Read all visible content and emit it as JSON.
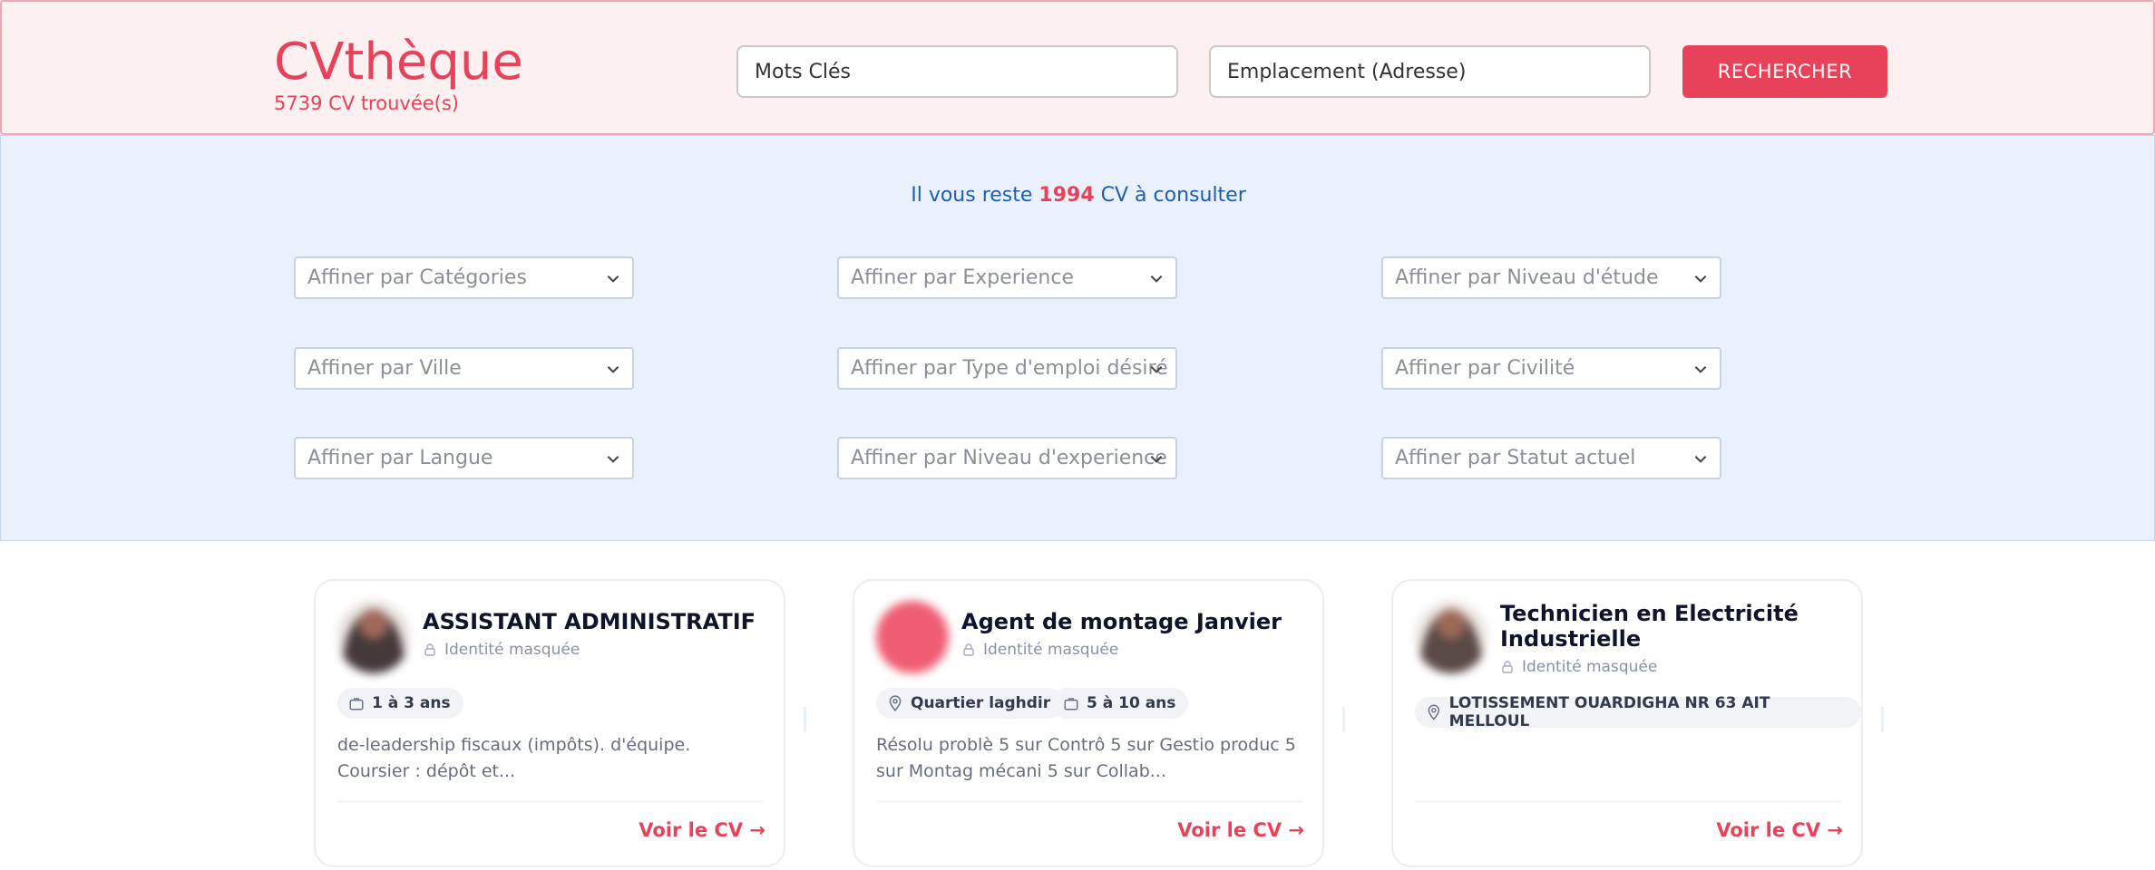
{
  "header": {
    "brand_title": "CVthèque",
    "brand_count": "5739 CV trouvée(s)",
    "keywords_placeholder": "Mots Clés",
    "location_placeholder": "Emplacement (Adresse)",
    "search_label": "RECHERCHER",
    "accent_color": "#e8415a"
  },
  "filters": {
    "remaining_prefix": "Il vous reste",
    "remaining_count": "1994",
    "remaining_suffix": "CV à consulter",
    "selects": [
      "Affiner par Catégories",
      "Affiner par Experience",
      "Affiner par Niveau d'étude",
      "Affiner par Ville",
      "Affiner par Type d'emploi désiré",
      "Affiner par Civilité",
      "Affiner par Langue",
      "Affiner par Niveau d'experience",
      "Affiner par Statut actuel"
    ]
  },
  "cards": [
    {
      "title": "ASSISTANT ADMINISTRATIF",
      "identity": "Identité masquée",
      "experience": "1 à 3 ans",
      "excerpt": "de-leadership fiscaux (impôts). d'équipe. Coursier : dépôt et...",
      "link": "Voir le CV →"
    },
    {
      "title": "Agent de montage Janvier",
      "identity": "Identité masquée",
      "location": "Quartier laghdir",
      "experience": "5 à 10 ans",
      "excerpt": "Résolu problè 5 sur Contrô 5 sur Gestio produc 5 sur Montag mécani 5 sur Collab...",
      "link": "Voir le CV →"
    },
    {
      "title_line1": "Technicien en Electricité",
      "title_line2": "Industrielle",
      "identity": "Identité masquée",
      "location": "LOTISSEMENT OUARDIGHA NR 63 AIT MELLOUL",
      "link": "Voir le CV →"
    }
  ]
}
